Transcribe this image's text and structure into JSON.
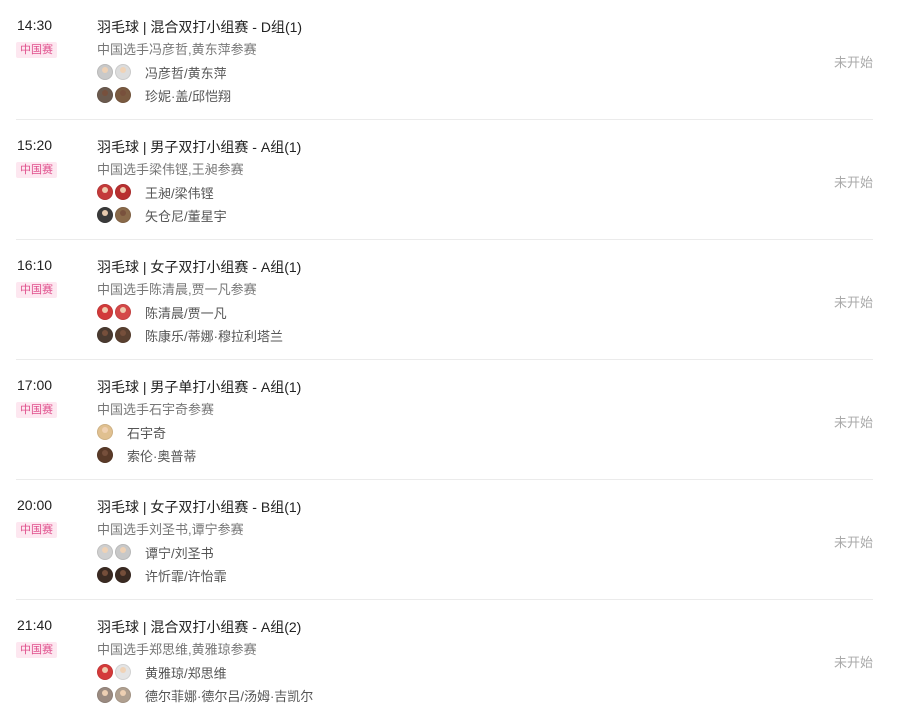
{
  "badge_label": "中国赛",
  "matches": [
    {
      "time": "14:30",
      "title": "羽毛球 | 混合双打小组赛 - D组(1)",
      "subtitle": "中国选手冯彦哲,黄东萍参赛",
      "team1": "冯彦哲/黄东萍",
      "team2": "珍妮·盖/邱恺翔",
      "status": "未开始"
    },
    {
      "time": "15:20",
      "title": "羽毛球 | 男子双打小组赛 - A组(1)",
      "subtitle": "中国选手梁伟铿,王昶参赛",
      "team1": "王昶/梁伟铿",
      "team2": "矢仓尼/董星宇",
      "status": "未开始"
    },
    {
      "time": "16:10",
      "title": "羽毛球 | 女子双打小组赛 - A组(1)",
      "subtitle": "中国选手陈清晨,贾一凡参赛",
      "team1": "陈清晨/贾一凡",
      "team2": "陈康乐/蒂娜·穆拉利塔兰",
      "status": "未开始"
    },
    {
      "time": "17:00",
      "title": "羽毛球 | 男子单打小组赛 - A组(1)",
      "subtitle": "中国选手石宇奇参赛",
      "team1": "石宇奇",
      "team2": "索伦·奥普蒂",
      "status": "未开始"
    },
    {
      "time": "20:00",
      "title": "羽毛球 | 女子双打小组赛 - B组(1)",
      "subtitle": "中国选手刘圣书,谭宁参赛",
      "team1": "谭宁/刘圣书",
      "team2": "许忻霏/许怡霏",
      "status": "未开始"
    },
    {
      "time": "21:40",
      "title": "羽毛球 | 混合双打小组赛 - A组(2)",
      "subtitle": "中国选手郑思维,黄雅琼参赛",
      "team1": "黄雅琼/郑思维",
      "team2": "德尔菲娜·德尔吕/汤姆·吉凯尔",
      "status": "未开始"
    }
  ]
}
